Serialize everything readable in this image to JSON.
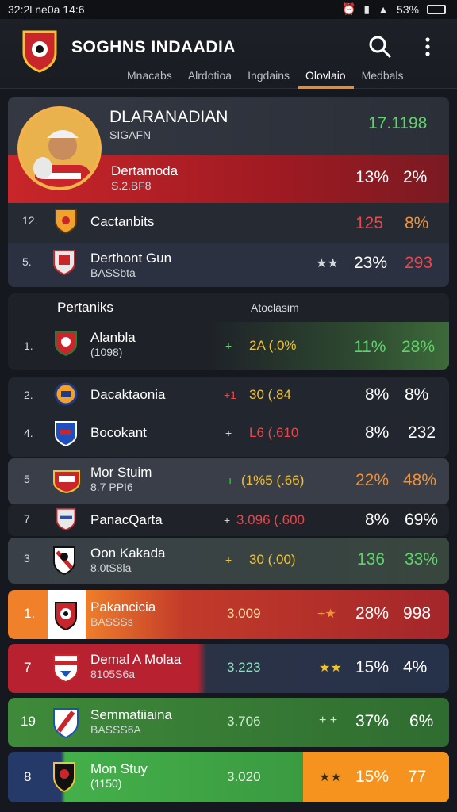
{
  "status_bar": {
    "time": "32:2l ne0a 14:6",
    "battery": "53%"
  },
  "app": {
    "title": "SOGHNS INDAADIA"
  },
  "tabs": [
    "Mnacabs",
    "Alrdotioa",
    "Ingdains",
    "Olovlaio",
    "Medbals"
  ],
  "active_tab_index": 3,
  "featured": {
    "name": "DLARANADIAN",
    "subtitle": "SIGAFN",
    "value": "17.1198",
    "highlight": {
      "name": "Dertamoda",
      "sub": "S.2.BF8",
      "pct1": "13%",
      "pct2": "2%"
    },
    "rows": [
      {
        "rank": "12.",
        "name": "Cactanbits",
        "sub": "",
        "arrows": "",
        "pct1": "125",
        "pct2": "8%"
      },
      {
        "rank": "5.",
        "name": "Derthont Gun",
        "sub": "BASSbta",
        "arrows": "★★",
        "pct1": "23%",
        "pct2": "293"
      }
    ]
  },
  "section": {
    "title": "Pertaniks",
    "column": "Atoclasim",
    "first_row": {
      "rank": "1.",
      "name": "Alanbla",
      "sub": "(1098)",
      "arrow": "+",
      "value": "2A (.0%",
      "pct1": "11%",
      "pct2": "28%"
    }
  },
  "rows": [
    {
      "rank": "2.",
      "name": "Dacaktaonia",
      "sub": "",
      "arrow": "+1",
      "value": "30 (.84",
      "pct1": "8%",
      "pct2": "8%"
    },
    {
      "rank": "4.",
      "name": "Bocokant",
      "sub": "",
      "arrow": "+",
      "value": "L6 (.610",
      "pct1": "8%",
      "pct2": "232"
    },
    {
      "rank": "5",
      "name": "Mor Stuim",
      "sub": "8.7 PPI6",
      "arrow": "+",
      "value": "(1%5 (.66)",
      "pct1": "22%",
      "pct2": "48%"
    },
    {
      "rank": "7",
      "name": "PanacQarta",
      "sub": "",
      "arrow": "+",
      "value": "3.096 (.600",
      "pct1": "8%",
      "pct2": "69%"
    },
    {
      "rank": "3",
      "name": "Oon Kakada",
      "sub": "8.0tS8la",
      "arrow": "+",
      "value": "30 (.00)",
      "pct1": "136",
      "pct2": "33%"
    }
  ],
  "colored_rows": [
    {
      "rank": "1.",
      "name": "Pakancicia",
      "sub": "BASSSs",
      "value": "3.009",
      "arrow": "+★",
      "pct1": "28%",
      "pct2": "998"
    },
    {
      "rank": "7",
      "name": "Demal A Molaa",
      "sub": "8105S6a",
      "value": "3.223",
      "arrow": "★★",
      "pct1": "15%",
      "pct2": "4%"
    },
    {
      "rank": "19",
      "name": "Semmatiiaina",
      "sub": "BASSS6A",
      "value": "3.706",
      "arrow": "+ +",
      "pct1": "37%",
      "pct2": "6%"
    },
    {
      "rank": "8",
      "name": "Mon Stuy",
      "sub": "(1150)",
      "value": "3.020",
      "arrow": "★★",
      "pct1": "15%",
      "pct2": "77"
    }
  ],
  "colors": {
    "accent": "#f08a24",
    "green": "#5fd46a",
    "red": "#c8262a"
  }
}
